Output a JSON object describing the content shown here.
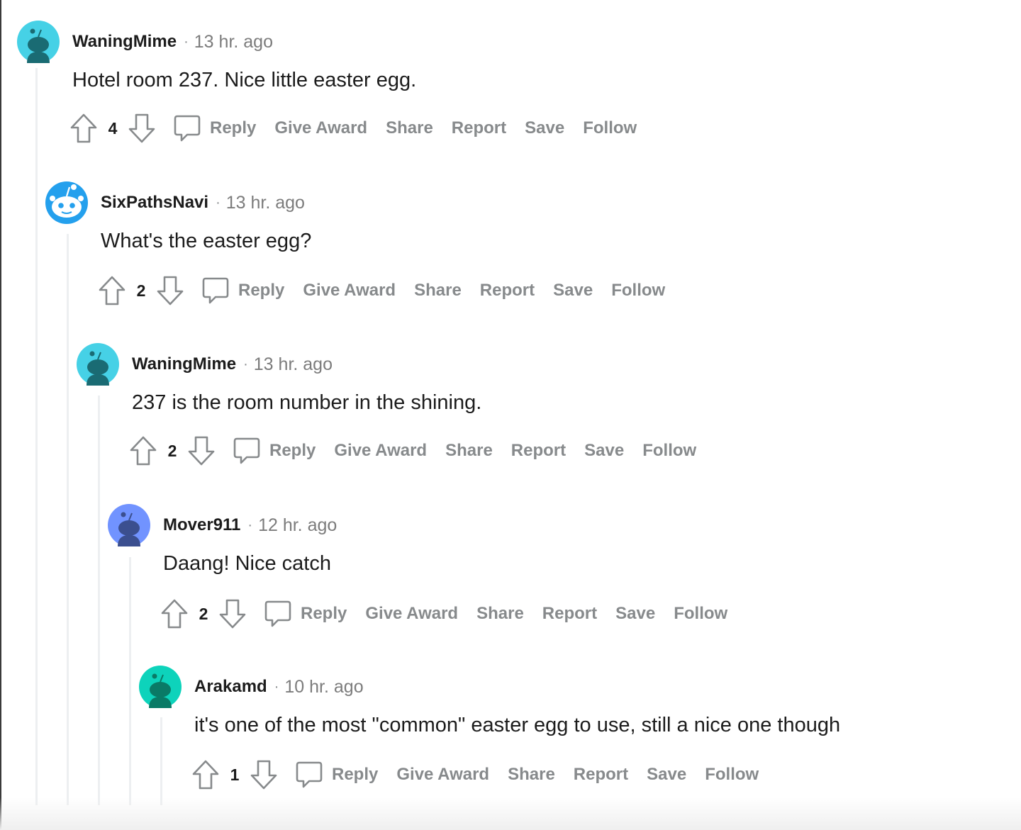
{
  "colors": {
    "text": "#1c1c1c",
    "meta": "#878a8c",
    "thread_line": "#edeff1"
  },
  "comments": [
    {
      "username": "WaningMime",
      "separator": "·",
      "time": "13 hr. ago",
      "body": "Hotel room 237. Nice little easter egg.",
      "votes": "4",
      "avatar_color": "#46d1e6",
      "avatar_icon": "snoo-avatar-icon"
    },
    {
      "username": "SixPathsNavi",
      "separator": "·",
      "time": "13 hr. ago",
      "body": "What's the easter egg?",
      "votes": "2",
      "avatar_color": "#24a0ed",
      "avatar_icon": "default-snoo-avatar-icon"
    },
    {
      "username": "WaningMime",
      "separator": "·",
      "time": "13 hr. ago",
      "body": "237 is the room number in the shining.",
      "votes": "2",
      "avatar_color": "#46d1e6",
      "avatar_icon": "snoo-avatar-icon"
    },
    {
      "username": "Mover911",
      "separator": "·",
      "time": "12 hr. ago",
      "body": "Daang! Nice catch",
      "votes": "2",
      "avatar_color": "#7193ff",
      "avatar_icon": "snoo-avatar-icon"
    },
    {
      "username": "Arakamd",
      "separator": "·",
      "time": "10 hr. ago",
      "body": "it's one of the most \"common\" easter egg to use, still a nice one though",
      "votes": "1",
      "avatar_color": "#0dd3bb",
      "avatar_icon": "snoo-avatar-icon"
    }
  ],
  "actions": {
    "reply": "Reply",
    "give_award": "Give Award",
    "share": "Share",
    "report": "Report",
    "save": "Save",
    "follow": "Follow"
  },
  "icons": {
    "upvote": "upvote-arrow-icon",
    "downvote": "downvote-arrow-icon",
    "reply": "speech-bubble-icon"
  }
}
